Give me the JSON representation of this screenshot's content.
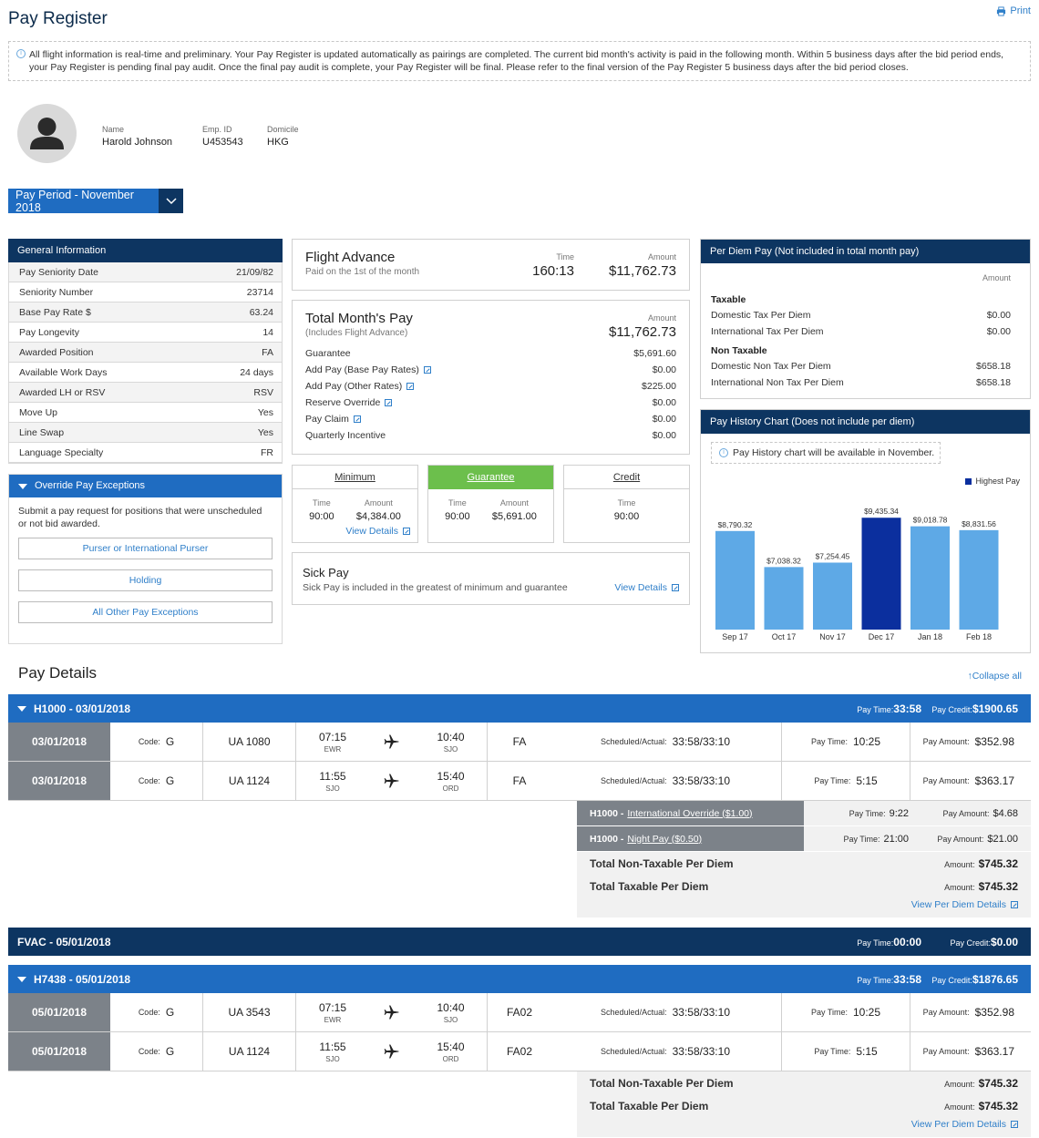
{
  "header": {
    "title": "Pay Register",
    "print_label": "Print"
  },
  "notice": "All flight information is real-time and preliminary. Your Pay Register is updated automatically as pairings are completed. The current bid month's activity is paid in the following month. Within 5 business days after the bid period ends, your Pay Register is pending final pay audit. Once the final pay audit is complete, your Pay Register will be final. Please refer to the final version of the Pay Register 5 business days after the bid period closes.",
  "profile": {
    "name_label": "Name",
    "name": "Harold Johnson",
    "emp_label": "Emp. ID",
    "emp": "U453543",
    "domicile_label": "Domicile",
    "domicile": "HKG"
  },
  "pay_period": "Pay Period - November 2018",
  "general_info": {
    "title": "General Information",
    "rows": [
      {
        "label": "Pay Seniority Date",
        "value": "21/09/82"
      },
      {
        "label": "Seniority Number",
        "value": "23714"
      },
      {
        "label": "Base Pay Rate $",
        "value": "63.24"
      },
      {
        "label": "Pay Longevity",
        "value": "14"
      },
      {
        "label": "Awarded Position",
        "value": "FA"
      },
      {
        "label": "Available Work Days",
        "value": "24 days"
      },
      {
        "label": "Awarded LH or RSV",
        "value": "RSV"
      },
      {
        "label": "Move Up",
        "value": "Yes"
      },
      {
        "label": "Line Swap",
        "value": "Yes"
      },
      {
        "label": "Language Specialty",
        "value": "FR"
      }
    ]
  },
  "override": {
    "title": "Override Pay Exceptions",
    "desc": "Submit a pay request for positions that were unscheduled or not bid awarded.",
    "buttons": [
      "Purser or International Purser",
      "Holding",
      "All Other Pay Exceptions"
    ]
  },
  "flight_advance": {
    "title": "Flight Advance",
    "sub": "Paid on the 1st of the month",
    "time_label": "Time",
    "time": "160:13",
    "amount_label": "Amount",
    "amount": "$11,762.73"
  },
  "total_pay": {
    "title": "Total Month's Pay",
    "sub": "(Includes Flight Advance)",
    "amount_label": "Amount",
    "amount": "$11,762.73",
    "rows": [
      {
        "label": "Guarantee",
        "value": "$5,691.60"
      },
      {
        "label": "Add Pay (Base Pay Rates)",
        "value": "$0.00"
      },
      {
        "label": "Add Pay (Other Rates)",
        "value": "$225.00"
      },
      {
        "label": "Reserve Override",
        "value": "$0.00"
      },
      {
        "label": "Pay Claim",
        "value": "$0.00"
      },
      {
        "label": "Quarterly Incentive",
        "value": "$0.00"
      }
    ]
  },
  "minimum": {
    "title": "Minimum",
    "time_label": "Time",
    "time": "90:00",
    "amount_label": "Amount",
    "amount": "$4,384.00",
    "link": "View Details"
  },
  "guarantee": {
    "title": "Guarantee",
    "time_label": "Time",
    "time": "90:00",
    "amount_label": "Amount",
    "amount": "$5,691.00"
  },
  "credit": {
    "title": "Credit",
    "time_label": "Time",
    "time": "90:00"
  },
  "sick": {
    "title": "Sick Pay",
    "desc": "Sick Pay is included in the greatest of minimum and guarantee",
    "link": "View Details"
  },
  "per_diem": {
    "title": "Per Diem Pay (Not included in total month pay)",
    "amount_label": "Amount",
    "taxable_label": "Taxable",
    "taxable": [
      {
        "label": "Domestic Tax Per Diem",
        "value": "$0.00"
      },
      {
        "label": "International Tax Per Diem",
        "value": "$0.00"
      }
    ],
    "nontax_label": "Non Taxable",
    "nontax": [
      {
        "label": "Domestic Non Tax Per Diem",
        "value": "$658.18"
      },
      {
        "label": "International Non Tax Per Diem",
        "value": "$658.18"
      }
    ]
  },
  "pay_history": {
    "title": "Pay History Chart (Does not include per diem)",
    "note": "Pay History chart will be available in November.",
    "legend": "Highest Pay"
  },
  "chart_data": {
    "type": "bar",
    "categories": [
      "Sep 17",
      "Oct 17",
      "Nov 17",
      "Dec 17",
      "Jan 18",
      "Feb 18"
    ],
    "values": [
      8790.32,
      7038.32,
      7254.45,
      9435.34,
      9018.78,
      8831.56
    ],
    "value_labels": [
      "$8,790.32",
      "$7,038.32",
      "$7,254.45",
      "$9,435.34",
      "$9,018.78",
      "$8,831.56"
    ],
    "highlight_index": 3,
    "colors": {
      "normal": "#5ea9e6",
      "highest": "#0b2f9e"
    },
    "ylim": [
      4000,
      9800
    ],
    "legend": "Highest Pay"
  },
  "pay_details": {
    "title": "Pay Details",
    "collapse": "Collapse all",
    "labels": {
      "code": "Code:",
      "sched": "Scheduled/Actual:",
      "pay_time": "Pay Time:",
      "pay_amount": "Pay Amount:",
      "pay_credit": "Pay Credit:",
      "amount": "Amount:",
      "view_per_diem": "View Per Diem Details"
    },
    "g1": {
      "title": "H1000 - 03/01/2018",
      "pay_time": "33:58",
      "pay_credit": "$1900.65",
      "rows": [
        {
          "date": "03/01/2018",
          "code": "G",
          "flight": "UA 1080",
          "dep_time": "07:15",
          "dep": "EWR",
          "arr_time": "10:40",
          "arr": "SJO",
          "pos": "FA",
          "sched": "33:58/33:10",
          "pay_time": "10:25",
          "pay_amount": "$352.98"
        },
        {
          "date": "03/01/2018",
          "code": "G",
          "flight": "UA 1124",
          "dep_time": "11:55",
          "dep": "SJO",
          "arr_time": "15:40",
          "arr": "ORD",
          "pos": "FA",
          "sched": "33:58/33:10",
          "pay_time": "5:15",
          "pay_amount": "$363.17"
        }
      ],
      "adj": [
        {
          "code": "H1000 -",
          "link": "International Override ($1.00)",
          "pay_time": "9:22",
          "pay_amount": "$4.68"
        },
        {
          "code": "H1000 -",
          "link": "Night Pay ($0.50)",
          "pay_time": "21:00",
          "pay_amount": "$21.00"
        }
      ],
      "nontax_label": "Total Non-Taxable Per Diem",
      "nontax": "$745.32",
      "tax_label": "Total Taxable Per Diem",
      "tax": "$745.32"
    },
    "fvac": {
      "title": "FVAC - 05/01/2018",
      "pay_time": "00:00",
      "pay_credit": "$0.00"
    },
    "g2": {
      "title": "H7438 - 05/01/2018",
      "pay_time": "33:58",
      "pay_credit": "$1876.65",
      "rows": [
        {
          "date": "05/01/2018",
          "code": "G",
          "flight": "UA 3543",
          "dep_time": "07:15",
          "dep": "EWR",
          "arr_time": "10:40",
          "arr": "SJO",
          "pos": "FA02",
          "sched": "33:58/33:10",
          "pay_time": "10:25",
          "pay_amount": "$352.98"
        },
        {
          "date": "05/01/2018",
          "code": "G",
          "flight": "UA 1124",
          "dep_time": "11:55",
          "dep": "SJO",
          "arr_time": "15:40",
          "arr": "ORD",
          "pos": "FA02",
          "sched": "33:58/33:10",
          "pay_time": "5:15",
          "pay_amount": "$363.17"
        }
      ],
      "nontax_label": "Total Non-Taxable Per Diem",
      "nontax": "$745.32",
      "tax_label": "Total Taxable Per Diem",
      "tax": "$745.32"
    }
  }
}
